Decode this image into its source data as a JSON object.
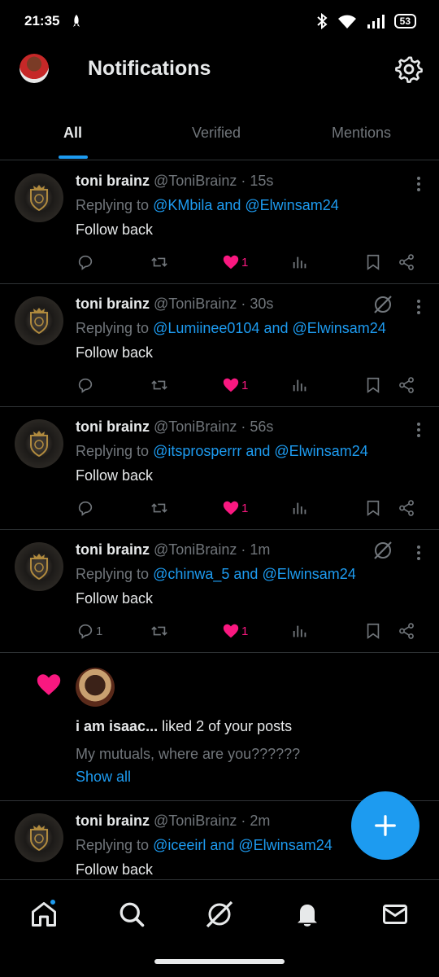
{
  "status_bar": {
    "time": "21:35",
    "battery": "53"
  },
  "header": {
    "title": "Notifications"
  },
  "tabs": [
    {
      "label": "All",
      "active": true
    },
    {
      "label": "Verified",
      "active": false
    },
    {
      "label": "Mentions",
      "active": false
    }
  ],
  "posts": [
    {
      "author": "toni brainz",
      "handle": "@ToniBrainz",
      "time": "15s",
      "replying_prefix": "Replying to ",
      "reply_a": "@KMbila",
      "and": " and ",
      "reply_b": "@Elwinsam24",
      "text": "Follow back",
      "likes": "1",
      "replies": "",
      "grok": false
    },
    {
      "author": "toni brainz",
      "handle": "@ToniBrainz",
      "time": "30s",
      "replying_prefix": "Replying to ",
      "reply_a": "@Lumiinee0104",
      "and": " and ",
      "reply_b": "@Elwinsam24",
      "text": "Follow back",
      "likes": "1",
      "replies": "",
      "grok": true
    },
    {
      "author": "toni brainz",
      "handle": "@ToniBrainz",
      "time": "56s",
      "replying_prefix": "Replying to ",
      "reply_a": "@itsprosperrr",
      "and": " and ",
      "reply_b": "@Elwinsam24",
      "text": "Follow back",
      "likes": "1",
      "replies": "",
      "grok": false
    },
    {
      "author": "toni brainz",
      "handle": "@ToniBrainz",
      "time": "1m",
      "replying_prefix": "Replying to ",
      "reply_a": "@chinwa_5",
      "and": " and ",
      "reply_b": "@Elwinsam24",
      "text": "Follow back",
      "likes": "1",
      "replies": "1",
      "grok": true
    }
  ],
  "like_notification": {
    "user": "i am isaac...",
    "action": " liked 2 of your posts",
    "preview": "My mutuals, where are you??????",
    "show_all": "Show all"
  },
  "last_post": {
    "author": "toni brainz",
    "handle": "@ToniBrainz",
    "time": "2m",
    "replying_prefix": "Replying to ",
    "reply_a": "@iceeirl",
    "and": " and ",
    "reply_b": "@Elwinsam24",
    "text": "Follow back"
  },
  "colors": {
    "accent": "#1d9bf0",
    "like": "#f91880",
    "muted": "#71767b",
    "background": "#000000"
  },
  "icons": [
    "bluetooth-icon",
    "wifi-icon",
    "signal-icon",
    "settings-gear-icon",
    "reply-icon",
    "retweet-icon",
    "heart-icon",
    "views-icon",
    "bookmark-icon",
    "share-icon",
    "grok-icon",
    "compose-plus-icon",
    "home-icon",
    "search-icon",
    "grok-nav-icon",
    "bell-icon",
    "mail-icon"
  ]
}
